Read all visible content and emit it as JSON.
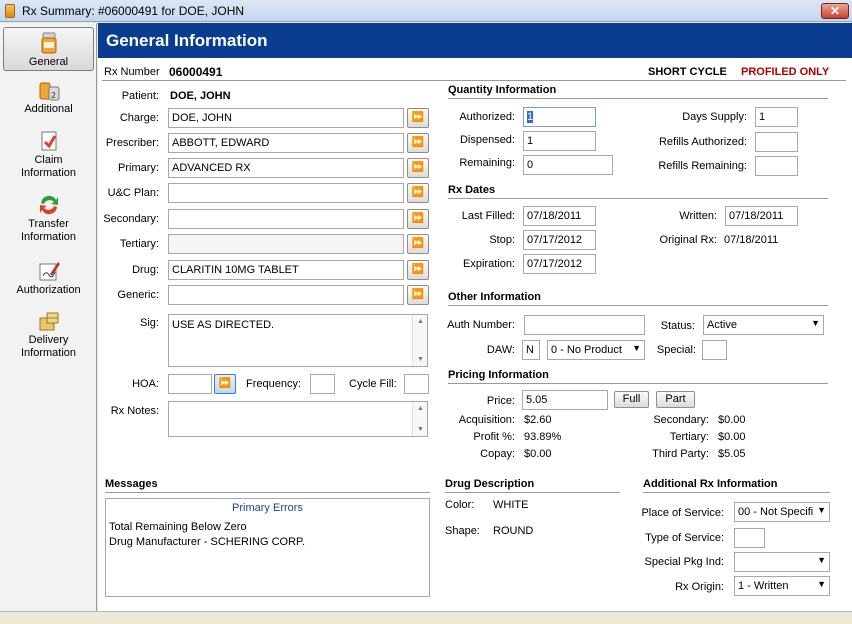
{
  "window": {
    "title": "Rx Summary: #06000491 for DOE, JOHN",
    "close": "✕"
  },
  "sidebar": {
    "items": [
      {
        "label": "General",
        "icon": "pill-bottle-icon"
      },
      {
        "label": "Additional",
        "icon": "pill-bottles-icon"
      },
      {
        "label": "Claim Information",
        "icon": "claim-document-icon"
      },
      {
        "label": "Transfer Information",
        "icon": "transfer-arrows-icon"
      },
      {
        "label": "Authorization",
        "icon": "signature-pen-icon"
      },
      {
        "label": "Delivery Information",
        "icon": "delivery-package-icon"
      }
    ]
  },
  "header": {
    "title": "General Information"
  },
  "rx": {
    "number_label": "Rx Number",
    "number": "06000491",
    "short_cycle": "SHORT CYCLE",
    "profiled_only": "PROFILED ONLY"
  },
  "left": {
    "patient_label": "Patient:",
    "patient": "DOE, JOHN",
    "charge_label": "Charge:",
    "charge": "DOE, JOHN",
    "prescriber_label": "Prescriber:",
    "prescriber": "ABBOTT, EDWARD",
    "primary_label": "Primary:",
    "primary": "ADVANCED RX",
    "uc_plan_label": "U&C Plan:",
    "uc_plan": "",
    "secondary_label": "Secondary:",
    "secondary": "",
    "tertiary_label": "Tertiary:",
    "tertiary": "",
    "drug_label": "Drug:",
    "drug": "CLARITIN 10MG TABLET",
    "generic_label": "Generic:",
    "generic": "",
    "sig_label": "Sig:",
    "sig": "USE AS DIRECTED.",
    "hoa_label": "HOA:",
    "hoa": "",
    "frequency_label": "Frequency:",
    "frequency": "",
    "cycle_fill_label": "Cycle Fill:",
    "cycle_fill": "",
    "rx_notes_label": "Rx Notes:",
    "rx_notes": "",
    "lookup_glyph": "⏩"
  },
  "quantity": {
    "title": "Quantity Information",
    "authorized_label": "Authorized:",
    "authorized": "1",
    "dispensed_label": "Dispensed:",
    "dispensed": "1",
    "remaining_label": "Remaining:",
    "remaining": "0",
    "days_supply_label": "Days Supply:",
    "days_supply": "1",
    "refills_authorized_label": "Refills Authorized:",
    "refills_authorized": "",
    "refills_remaining_label": "Refills Remaining:",
    "refills_remaining": ""
  },
  "dates": {
    "title": "Rx Dates",
    "last_filled_label": "Last Filled:",
    "last_filled": "07/18/2011",
    "stop_label": "Stop:",
    "stop": "07/17/2012",
    "expiration_label": "Expiration:",
    "expiration": "07/17/2012",
    "written_label": "Written:",
    "written": "07/18/2011",
    "original_rx_label": "Original Rx:",
    "original_rx": "07/18/2011"
  },
  "other": {
    "title": "Other Information",
    "auth_number_label": "Auth Number:",
    "auth_number": "",
    "status_label": "Status:",
    "status": "Active",
    "daw_label": "DAW:",
    "daw_code": "N",
    "daw": "0 - No Product",
    "special_label": "Special:",
    "special": ""
  },
  "pricing": {
    "title": "Pricing Information",
    "price_label": "Price:",
    "price": "5.05",
    "full_button": "Full",
    "part_button": "Part",
    "acquisition_label": "Acquisition:",
    "acquisition": "$2.60",
    "profit_label": "Profit %:",
    "profit": "93.89%",
    "copay_label": "Copay:",
    "copay": "$0.00",
    "secondary_label": "Secondary:",
    "secondary": "$0.00",
    "tertiary_label": "Tertiary:",
    "tertiary": "$0.00",
    "third_party_label": "Third Party:",
    "third_party": "$5.05"
  },
  "messages": {
    "title": "Messages",
    "header": "Primary Errors",
    "lines": [
      "Total Remaining Below Zero",
      "Drug Manufacturer - SCHERING CORP."
    ]
  },
  "drug_desc": {
    "title": "Drug Description",
    "color_label": "Color:",
    "color": "WHITE",
    "shape_label": "Shape:",
    "shape": "ROUND"
  },
  "additional_rx": {
    "title": "Additional Rx Information",
    "place_label": "Place of Service:",
    "place": "00 - Not Specifi",
    "type_label": "Type of Service:",
    "type": "",
    "special_pkg_label": "Special Pkg Ind:",
    "special_pkg": "",
    "origin_label": "Rx Origin:",
    "origin": "1 - Written"
  },
  "colors": {
    "header_bg": "#0a3d8f",
    "profiled_red": "#b00000",
    "messages_header": "#1b3f9e"
  }
}
